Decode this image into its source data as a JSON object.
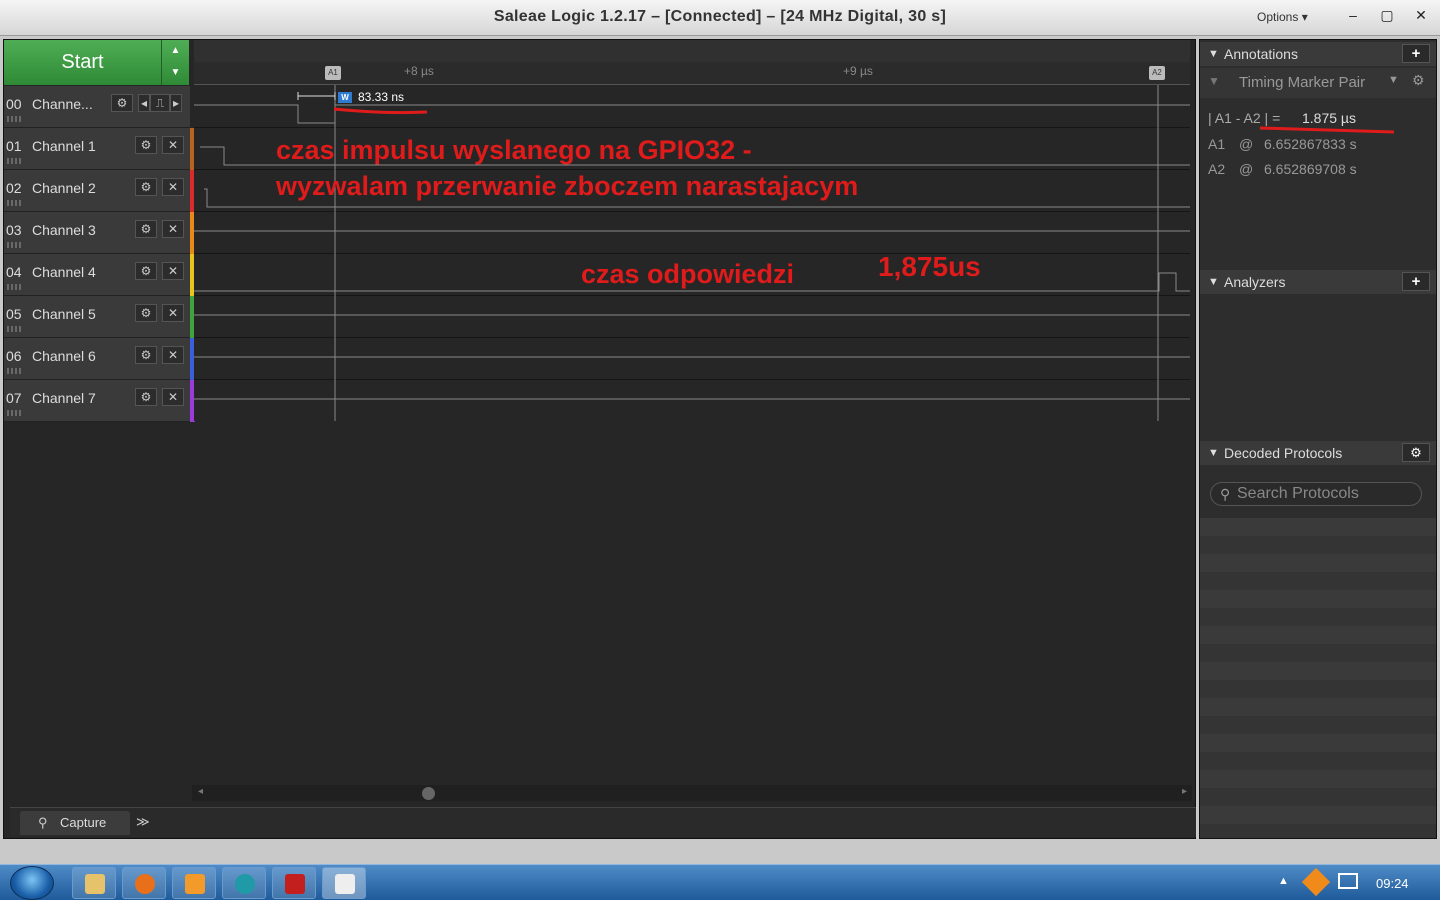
{
  "window": {
    "title": "Saleae Logic 1.2.17 – [Connected] – [24 MHz Digital, 30 s]",
    "options_label": "Options",
    "minimize": "–",
    "restore": "▢",
    "close": "✕"
  },
  "capture": {
    "start_label": "Start",
    "up_arrow": "▲",
    "down_arrow": "▼"
  },
  "channels": [
    {
      "num": "00",
      "name": "Channe...",
      "color": "#2a2a2a"
    },
    {
      "num": "01",
      "name": "Channel 1",
      "color": "#b5651d"
    },
    {
      "num": "02",
      "name": "Channel 2",
      "color": "#d92b2b"
    },
    {
      "num": "03",
      "name": "Channel 3",
      "color": "#e8891a"
    },
    {
      "num": "04",
      "name": "Channel 4",
      "color": "#e8c51a"
    },
    {
      "num": "05",
      "name": "Channel 5",
      "color": "#3fa33f"
    },
    {
      "num": "06",
      "name": "Channel 6",
      "color": "#3b5fd9"
    },
    {
      "num": "07",
      "name": "Channel 7",
      "color": "#9b3bd9"
    }
  ],
  "channel_buttons": {
    "settings": "⚙",
    "close": "✕",
    "prev": "◂",
    "trigger": "⎍",
    "next": "▸"
  },
  "ruler": {
    "tick_8": "+8 µs",
    "tick_9": "+9 µs",
    "marker_a1": "A1",
    "marker_a2": "A2"
  },
  "measurement": {
    "width_badge": "W",
    "width_value": "83.33 ns"
  },
  "annotations_overlay": {
    "line1": "czas impulsu wyslanego na GPIO32 -",
    "line2": "wyzwalam przerwanie zboczem narastajacym",
    "line3": "czas odpowiedzi",
    "line4": "1,875us"
  },
  "bottom": {
    "capture_tab": "Capture",
    "more": "≫"
  },
  "right_panel": {
    "annotations_title": "Annotations",
    "add": "+",
    "timing_marker_label": "Timing Marker Pair",
    "diff_expr": "| A1 - A2 | =",
    "diff_value": "1.875 µs",
    "a1_label": "A1",
    "a1_at": "@",
    "a1_value": "6.652867833 s",
    "a2_label": "A2",
    "a2_at": "@",
    "a2_value": "6.652869708 s",
    "analyzers_title": "Analyzers",
    "decoded_title": "Decoded Protocols",
    "search_placeholder": "Search Protocols"
  },
  "taskbar": {
    "clock": "09:24"
  }
}
